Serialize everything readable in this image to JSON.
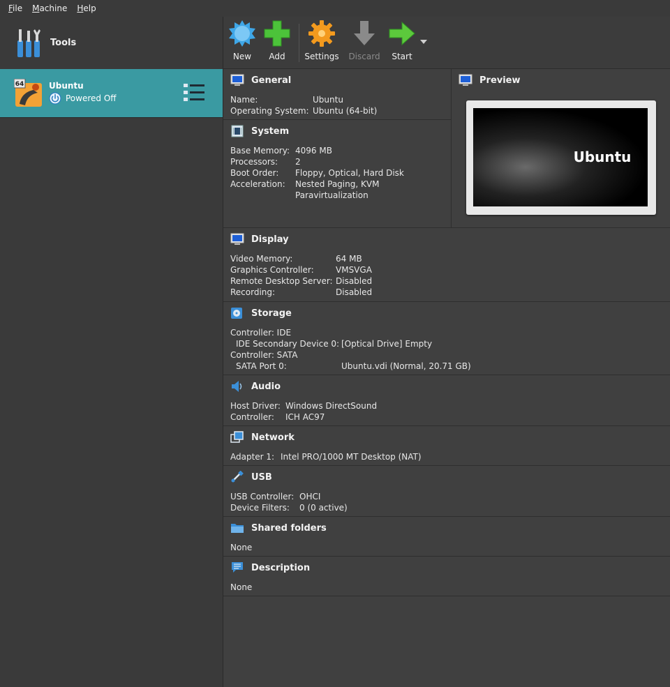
{
  "menu": {
    "items": [
      {
        "u": "F",
        "rest": "ile"
      },
      {
        "u": "M",
        "rest": "achine"
      },
      {
        "u": "H",
        "rest": "elp"
      }
    ]
  },
  "tools": {
    "label": "Tools"
  },
  "vm": {
    "name": "Ubuntu",
    "state": "Powered Off",
    "badge": "64"
  },
  "toolbar": {
    "new": "New",
    "add": "Add",
    "settings": "Settings",
    "discard": "Discard",
    "start": "Start"
  },
  "general": {
    "title": "General",
    "rows": [
      {
        "k": "Name:",
        "v": "Ubuntu"
      },
      {
        "k": "Operating System:",
        "v": "Ubuntu (64-bit)"
      }
    ]
  },
  "system": {
    "title": "System",
    "rows": [
      {
        "k": "Base Memory:",
        "v": "4096 MB"
      },
      {
        "k": "Processors:",
        "v": "2"
      },
      {
        "k": "Boot Order:",
        "v": "Floppy, Optical, Hard Disk"
      },
      {
        "k": "Acceleration:",
        "v": "Nested Paging, KVM"
      },
      {
        "k": "",
        "v": "Paravirtualization"
      }
    ]
  },
  "preview": {
    "title": "Preview",
    "screen_text": "Ubuntu"
  },
  "display": {
    "title": "Display",
    "rows": [
      {
        "k": "Video Memory:",
        "v": "64 MB"
      },
      {
        "k": "Graphics Controller:",
        "v": "VMSVGA"
      },
      {
        "k": "Remote Desktop Server:",
        "v": "Disabled"
      },
      {
        "k": "Recording:",
        "v": "Disabled"
      }
    ]
  },
  "storage": {
    "title": "Storage",
    "rows": [
      {
        "k": "Controller: IDE",
        "v": ""
      },
      {
        "k": "  IDE Secondary Device 0:",
        "v": "[Optical Drive] Empty"
      },
      {
        "k": "Controller: SATA",
        "v": ""
      },
      {
        "k": "  SATA Port 0:",
        "v": "Ubuntu.vdi (Normal, 20.71 GB)"
      }
    ]
  },
  "audio": {
    "title": "Audio",
    "rows": [
      {
        "k": "Host Driver:",
        "v": "Windows DirectSound"
      },
      {
        "k": "Controller:",
        "v": "ICH AC97"
      }
    ]
  },
  "network": {
    "title": "Network",
    "rows": [
      {
        "k": "Adapter 1:",
        "v": "Intel PRO/1000 MT Desktop (NAT)"
      }
    ]
  },
  "usb": {
    "title": "USB",
    "rows": [
      {
        "k": "USB Controller:",
        "v": "OHCI"
      },
      {
        "k": "Device Filters:",
        "v": "0 (0 active)"
      }
    ]
  },
  "shared": {
    "title": "Shared folders",
    "rows": [
      {
        "k": "None",
        "v": ""
      }
    ]
  },
  "description": {
    "title": "Description",
    "rows": [
      {
        "k": "None",
        "v": ""
      }
    ]
  },
  "colors": {
    "selection": "#3a9aa2",
    "background": "#404040",
    "menubar": "#3a3a3a"
  }
}
